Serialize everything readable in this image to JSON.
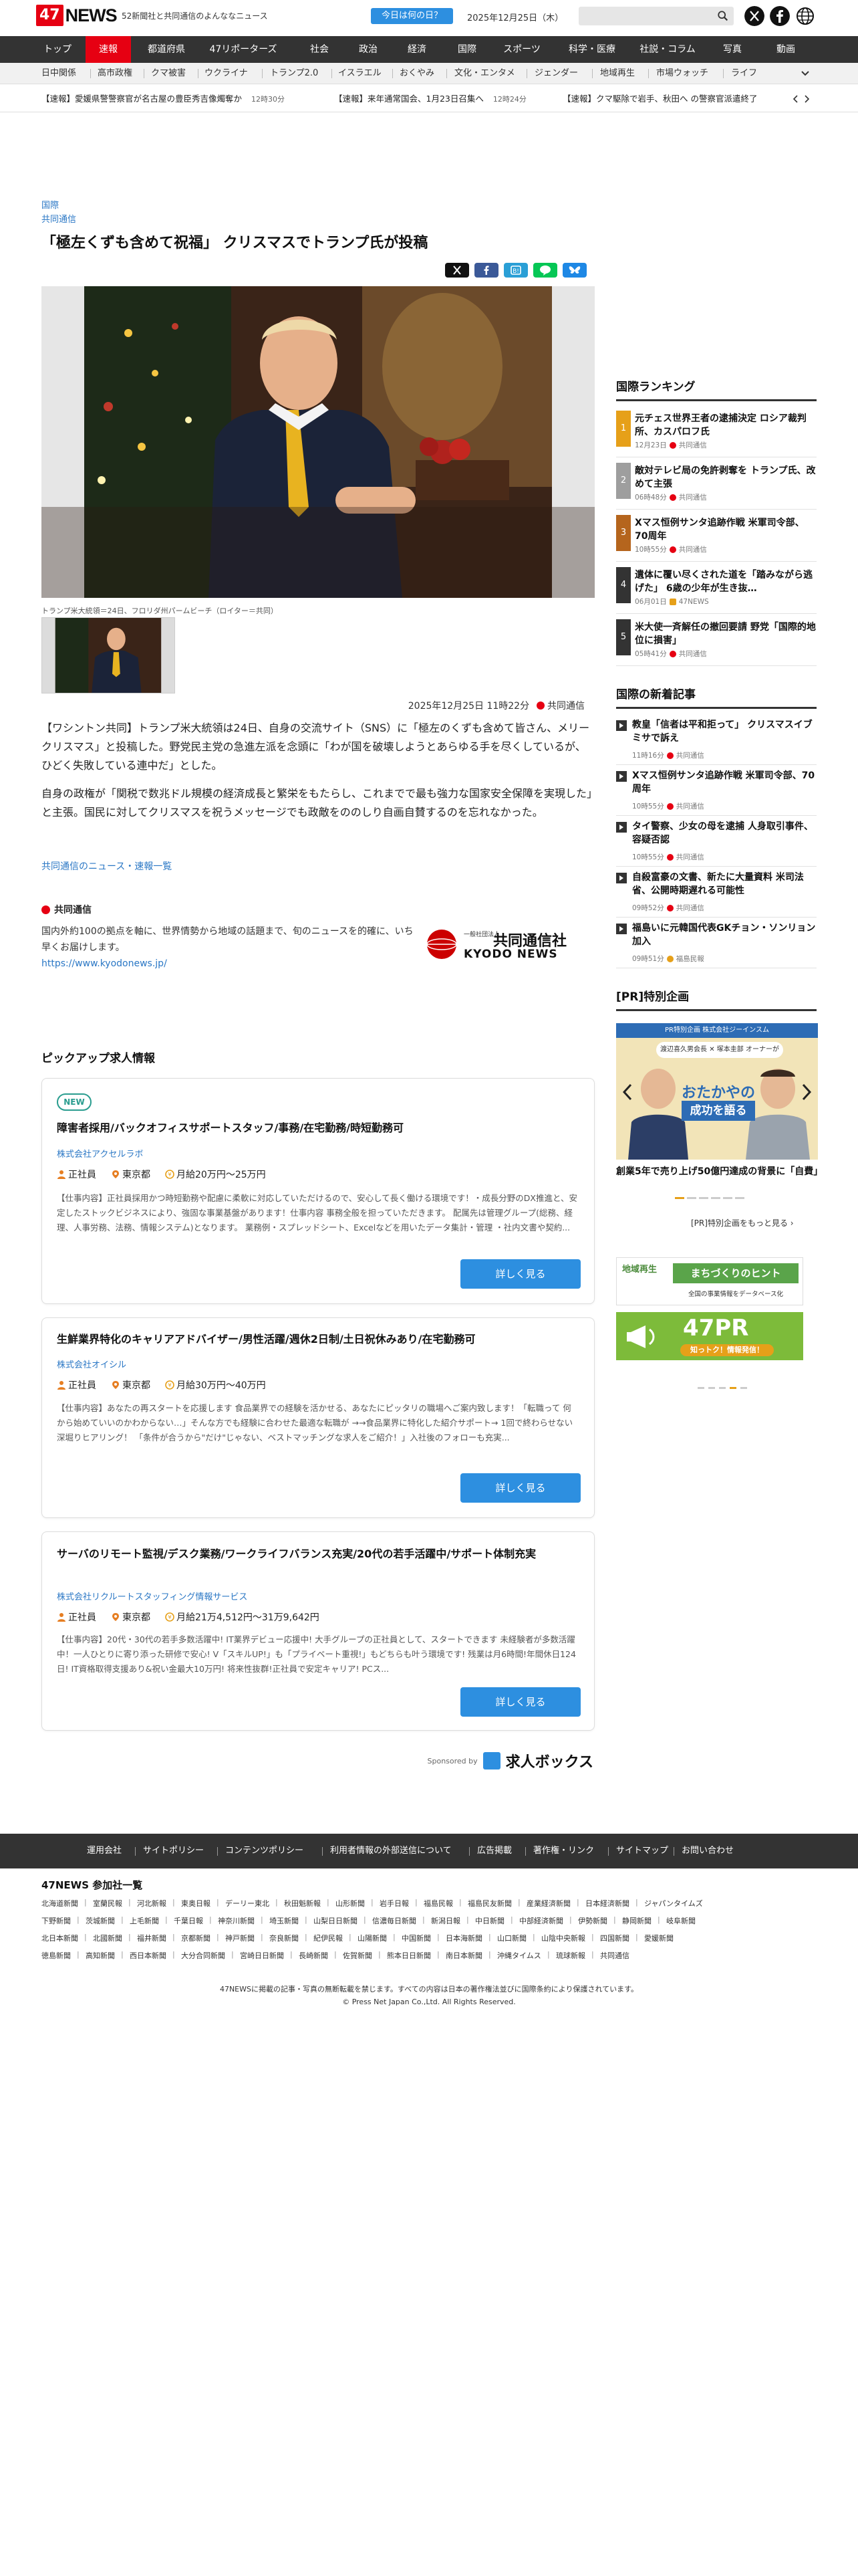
{
  "header": {
    "logo_num": "47",
    "logo_text": "NEWS",
    "tagline": "52新聞社と共同通信のよんななニュース",
    "today_button": "今日は何の日？",
    "date": "2025年12月25日（木）"
  },
  "nav": [
    "トップ",
    "速報",
    "都道府県",
    "47リポーターズ",
    "社会",
    "政治",
    "経済",
    "国際",
    "スポーツ",
    "科学・医療",
    "社説・コラム",
    "写真",
    "動画"
  ],
  "subnav": [
    "日中関係",
    "高市政権",
    "クマ被害",
    "ウクライナ",
    "トランプ2.0",
    "イスラエル",
    "おくやみ",
    "文化・エンタメ",
    "ジェンダー",
    "地域再生",
    "市場ウォッチ",
    "ライフ"
  ],
  "ticker": [
    {
      "text": "【速報】愛媛県警警察官が名古屋の豊臣秀吉像燭奪か",
      "time": "12時30分"
    },
    {
      "text": "【速報】来年通常国会、1月23日召集へ",
      "time": "12時24分"
    },
    {
      "text": "【速報】クマ駆除で岩手、秋田へ の警察官派遣終了"
    }
  ],
  "article": {
    "category": "国際",
    "source": "共同通信",
    "title": "「極左くずも含めて祝福」 クリスマスでトランプ氏が投稿",
    "caption": "トランプ米大統領＝24日、フロリダ州パームビーチ（ロイター＝共同）",
    "datetime": "2025年12月25日 11時22分",
    "provider": "共同通信",
    "paragraphs": [
      "【ワシントン共同】トランプ米大統領は24日、自身の交流サイト（SNS）に「極左のくずも含めて皆さん、メリークリスマス」と投稿した。野党民主党の急進左派を念頭に「わが国を破壊しようとあらゆる手を尽くしているが、ひどく失敗している連中だ」とした。",
      "自身の政権が「関税で数兆ドル規模の経済成長と繁栄をもたらし、これまでで最も強力な国家安全保障を実現した」と主張。国民に対してクリスマスを祝うメッセージでも政敵をののしり自画自賛するのを忘れなかった。"
    ],
    "more_link": "共同通信のニュース・速報一覧"
  },
  "kyodo": {
    "name": "共同通信",
    "desc": "国内外約100の拠点を軸に、世界情勢から地域の話題まで、旬のニュースを的確に、いち早くお届けします。",
    "url": "https://www.kyodonews.jp/",
    "logo_small": "一般社団法人",
    "logo_jp": "共同通信社",
    "logo_en": "KYODO NEWS"
  },
  "pickup": {
    "heading": "ピックアップ求人情報",
    "new_badge": "NEW",
    "button": "詳しく見る",
    "jobs": [
      {
        "title": "障害者採用/バックオフィスサポートスタッフ/事務/在宅勤務/時短勤務可",
        "company": "株式会社アクセルラボ",
        "type": "正社員",
        "place": "東京都",
        "salary": "月給20万円〜25万円",
        "desc": "【仕事内容】正社員採用かつ時短勤務や配慮に柔軟に対応していただけるので、安心して長く働ける環境です！・成長分野のDX推進と、安定したストックビジネスにより、強固な事業基盤があります！仕事内容 事務全般を担っていただきます。 配属先は管理グループ(総務、経理、人事労務、法務、情報システム)となります。 業務例・スプレッドシート、Excelなどを用いたデータ集計・管理 ・社内文書や契約..."
      },
      {
        "title": "生鮮業界特化のキャリアアドバイザー/男性活躍/週休2日制/土日祝休みあり/在宅勤務可",
        "company": "株式会社オイシル",
        "type": "正社員",
        "place": "東京都",
        "salary": "月給30万円〜40万円",
        "desc": "【仕事内容】あなたの再スタートを応援します 食品業界での経験を活かせる、あなたにピッタリの職場へご案内致します！「転職って 何から始めていいのかわからない…」そんな方でも経験に合わせた最適な転職が →→食品業界に特化した紹介サポート→ 1回で終わらせない深堀りヒアリング！ 「条件が合うから\"だけ\"じゃない、ベストマッチングな求人をご紹介！」入社後のフォローも充実..."
      },
      {
        "title": "サーバのリモート監視/デスク業務/ワークライフバランス充実/20代の若手活躍中/サポート体制充実",
        "company": "株式会社リクルートスタッフィング情報サービス",
        "type": "正社員",
        "place": "東京都",
        "salary": "月給21万4,512円〜31万9,642円",
        "desc": "【仕事内容】20代・30代の若手多数活躍中! IT業界デビュー応援中! 大手グループの正社員として、スタートできます 未経験者が多数活躍中！一人ひとりに寄り添った研修で安心! V「スキルUP!」も「プライベート重視!」もどちらも叶う環境です! 残業は月6時間!年間休日124日! IT資格取得支援あり&祝い金最大10万円! 将来性抜群!正社員で安定キャリア! PCス..."
      }
    ],
    "sponsored_by": "Sponsored by",
    "sponsor_brand": "求人ボックス"
  },
  "sidebar": {
    "ranking_heading": "国際ランキング",
    "ranking": [
      {
        "num": "1",
        "title": "元チェス世界王者の逮捕決定 ロシア裁判所、カスパロフ氏",
        "date": "12月23日",
        "src": "共同通信"
      },
      {
        "num": "2",
        "title": "敵対テレビ局の免許剥奪を トランプ氏、改めて主張",
        "date": "06時48分",
        "src": "共同通信"
      },
      {
        "num": "3",
        "title": "Xマス恒例サンタ追跡作戦 米軍司令部、70周年",
        "date": "10時55分",
        "src": "共同通信"
      },
      {
        "num": "4",
        "title": "遺体に覆い尽くされた道を「踏みながら逃げた」 6歳の少年が生き抜…",
        "date": "06月01日",
        "src": "47NEWS"
      },
      {
        "num": "5",
        "title": "米大使一斉解任の撤回要請 野党「国際的地位に損害」",
        "date": "05時41分",
        "src": "共同通信"
      }
    ],
    "newest_heading": "国際の新着記事",
    "newest": [
      {
        "title": "教皇「信者は平和拒って」 クリスマスイブミサで訴え",
        "date": "11時16分",
        "src": "共同通信"
      },
      {
        "title": "Xマス恒例サンタ追跡作戦 米軍司令部、70周年",
        "date": "10時55分",
        "src": "共同通信"
      },
      {
        "title": "タイ警察、少女の母を逮捕 人身取引事件、容疑否認",
        "date": "10時55分",
        "src": "共同通信"
      },
      {
        "title": "自殺富豪の文書、新たに大量資料 米司法省、公開時期遅れる可能性",
        "date": "09時52分",
        "src": "共同通信"
      },
      {
        "title": "福島いに元韓国代表GKチョン・ソンリョン加入",
        "date": "09時51分",
        "src": "福島民報"
      }
    ],
    "pr_heading": "[PR]特別企画",
    "pr_banner_top": "PR特別企画 株式会社ジーインスム",
    "pr_banner_names": "渡辺喜久男会長 ✕ 塚本圭部 オーナーが",
    "pr_banner_main": "おたかやの",
    "pr_banner_sub": "成功を語る",
    "pr_caption": "創業5年で売り上げ50億円達成の背景に「自費」の精神 渡辺喜久男会長…",
    "pr_more": "[PR]特別企画をもっと見る ›",
    "ad1_main": "まちづくりのヒント",
    "ad1_sub": "地域再生",
    "ad1_note": "全国の事業情報をデータベース化",
    "ad2_main": "47PR",
    "ad2_sub": "知っトク！情報発信！"
  },
  "footer": {
    "links": [
      "運用会社",
      "サイトポリシー",
      "コンテンツポリシー",
      "利用者情報の外部送信について",
      "広告掲載",
      "著作権・リンク",
      "サイトマップ",
      "お問い合わせ"
    ],
    "members_heading": "47NEWS 参加社一覧",
    "members": [
      [
        "北海道新聞",
        "室蘭民報",
        "河北新報",
        "東奥日報",
        "デーリー東北",
        "秋田魁新報",
        "山形新聞",
        "岩手日報",
        "福島民報",
        "福島民友新聞",
        "産業経済新聞",
        "日本経済新聞",
        "ジャパンタイムズ"
      ],
      [
        "下野新聞",
        "茨城新聞",
        "上毛新聞",
        "千葉日報",
        "神奈川新聞",
        "埼玉新聞",
        "山梨日日新聞",
        "信濃毎日新聞",
        "新潟日報",
        "中日新聞",
        "中部経済新聞",
        "伊勢新聞",
        "静岡新聞",
        "岐阜新聞"
      ],
      [
        "北日本新聞",
        "北國新聞",
        "福井新聞",
        "京都新聞",
        "神戸新聞",
        "奈良新聞",
        "紀伊民報",
        "山陽新聞",
        "中国新聞",
        "日本海新聞",
        "山口新聞",
        "山陰中央新報",
        "四国新聞",
        "愛媛新聞"
      ],
      [
        "徳島新聞",
        "高知新聞",
        "西日本新聞",
        "大分合同新聞",
        "宮崎日日新聞",
        "長崎新聞",
        "佐賀新聞",
        "熊本日日新聞",
        "南日本新聞",
        "沖縄タイムス",
        "琉球新報",
        "共同通信"
      ]
    ],
    "notice": "47NEWSに掲載の記事・写真の無断転載を禁じます。すべての内容は日本の著作権法並びに国際条約により保護されています。",
    "copyright": "© Press Net Japan Co.,Ltd. All Rights Reserved."
  },
  "colors": {
    "accent": "#e60012",
    "nav_bg": "#333333",
    "link": "#2a77c5",
    "button": "#2d8fe0"
  }
}
